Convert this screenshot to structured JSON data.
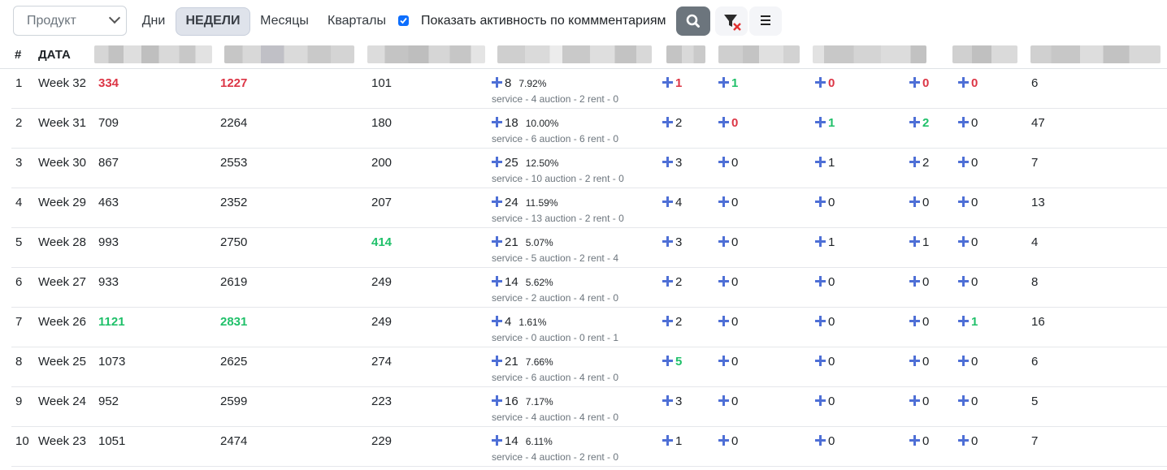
{
  "toolbar": {
    "product_placeholder": "Продукт",
    "periods": [
      "Дни",
      "НЕДЕЛИ",
      "Месяцы",
      "Кварталы"
    ],
    "active_period": "НЕДЕЛИ",
    "show_comments_checked": true,
    "show_comments_label": "Показать активность по коммментариям",
    "buttons": [
      "search-icon",
      "filter-clear-icon",
      "menu-icon"
    ]
  },
  "colors": {
    "accent": "#4e6fd6",
    "red": "#dc3545",
    "green": "#20c06a",
    "search_button": "#6c757d"
  },
  "table": {
    "headers": {
      "num": "#",
      "date": "ДАТА"
    },
    "rows": [
      {
        "n": "1",
        "date": "Week 32",
        "a": "334",
        "a_s": "red",
        "b": "1227",
        "b_s": "red",
        "c": "101",
        "c_s": "",
        "d": "8",
        "pct": "7.92%",
        "sub": "service - 4 auction - 2 rent - 0",
        "e": "1",
        "e_s": "red",
        "f": "1",
        "f_s": "green",
        "g": "0",
        "g_s": "red",
        "h": "0",
        "h_s": "red",
        "i": "0",
        "i_s": "red",
        "j": "6"
      },
      {
        "n": "2",
        "date": "Week 31",
        "a": "709",
        "a_s": "",
        "b": "2264",
        "b_s": "",
        "c": "180",
        "c_s": "",
        "d": "18",
        "pct": "10.00%",
        "sub": "service - 6 auction - 6 rent - 0",
        "e": "2",
        "e_s": "",
        "f": "0",
        "f_s": "red",
        "g": "1",
        "g_s": "green",
        "h": "2",
        "h_s": "green",
        "i": "0",
        "i_s": "",
        "j": "47"
      },
      {
        "n": "3",
        "date": "Week 30",
        "a": "867",
        "a_s": "",
        "b": "2553",
        "b_s": "",
        "c": "200",
        "c_s": "",
        "d": "25",
        "pct": "12.50%",
        "sub": "service - 10 auction - 2 rent - 0",
        "e": "3",
        "e_s": "",
        "f": "0",
        "f_s": "",
        "g": "1",
        "g_s": "",
        "h": "2",
        "h_s": "",
        "i": "0",
        "i_s": "",
        "j": "7"
      },
      {
        "n": "4",
        "date": "Week 29",
        "a": "463",
        "a_s": "",
        "b": "2352",
        "b_s": "",
        "c": "207",
        "c_s": "",
        "d": "24",
        "pct": "11.59%",
        "sub": "service - 13 auction - 2 rent - 0",
        "e": "4",
        "e_s": "",
        "f": "0",
        "f_s": "",
        "g": "0",
        "g_s": "",
        "h": "0",
        "h_s": "",
        "i": "0",
        "i_s": "",
        "j": "13"
      },
      {
        "n": "5",
        "date": "Week 28",
        "a": "993",
        "a_s": "",
        "b": "2750",
        "b_s": "",
        "c": "414",
        "c_s": "green",
        "d": "21",
        "pct": "5.07%",
        "sub": "service - 5 auction - 2 rent - 4",
        "e": "3",
        "e_s": "",
        "f": "0",
        "f_s": "",
        "g": "1",
        "g_s": "",
        "h": "1",
        "h_s": "",
        "i": "0",
        "i_s": "",
        "j": "4"
      },
      {
        "n": "6",
        "date": "Week 27",
        "a": "933",
        "a_s": "",
        "b": "2619",
        "b_s": "",
        "c": "249",
        "c_s": "",
        "d": "14",
        "pct": "5.62%",
        "sub": "service - 2 auction - 4 rent - 0",
        "e": "2",
        "e_s": "",
        "f": "0",
        "f_s": "",
        "g": "0",
        "g_s": "",
        "h": "0",
        "h_s": "",
        "i": "0",
        "i_s": "",
        "j": "8"
      },
      {
        "n": "7",
        "date": "Week 26",
        "a": "1121",
        "a_s": "green",
        "b": "2831",
        "b_s": "green",
        "c": "249",
        "c_s": "",
        "d": "4",
        "pct": "1.61%",
        "sub": "service - 0 auction - 0 rent - 1",
        "e": "2",
        "e_s": "",
        "f": "0",
        "f_s": "",
        "g": "0",
        "g_s": "",
        "h": "0",
        "h_s": "",
        "i": "1",
        "i_s": "green",
        "j": "16"
      },
      {
        "n": "8",
        "date": "Week 25",
        "a": "1073",
        "a_s": "",
        "b": "2625",
        "b_s": "",
        "c": "274",
        "c_s": "",
        "d": "21",
        "pct": "7.66%",
        "sub": "service - 6 auction - 4 rent - 0",
        "e": "5",
        "e_s": "green",
        "f": "0",
        "f_s": "",
        "g": "0",
        "g_s": "",
        "h": "0",
        "h_s": "",
        "i": "0",
        "i_s": "",
        "j": "6"
      },
      {
        "n": "9",
        "date": "Week 24",
        "a": "952",
        "a_s": "",
        "b": "2599",
        "b_s": "",
        "c": "223",
        "c_s": "",
        "d": "16",
        "pct": "7.17%",
        "sub": "service - 4 auction - 4 rent - 0",
        "e": "3",
        "e_s": "",
        "f": "0",
        "f_s": "",
        "g": "0",
        "g_s": "",
        "h": "0",
        "h_s": "",
        "i": "0",
        "i_s": "",
        "j": "5"
      },
      {
        "n": "10",
        "date": "Week 23",
        "a": "1051",
        "a_s": "",
        "b": "2474",
        "b_s": "",
        "c": "229",
        "c_s": "",
        "d": "14",
        "pct": "6.11%",
        "sub": "service - 4 auction - 2 rent - 0",
        "e": "1",
        "e_s": "",
        "f": "0",
        "f_s": "",
        "g": "0",
        "g_s": "",
        "h": "0",
        "h_s": "",
        "i": "0",
        "i_s": "",
        "j": "7"
      }
    ]
  }
}
